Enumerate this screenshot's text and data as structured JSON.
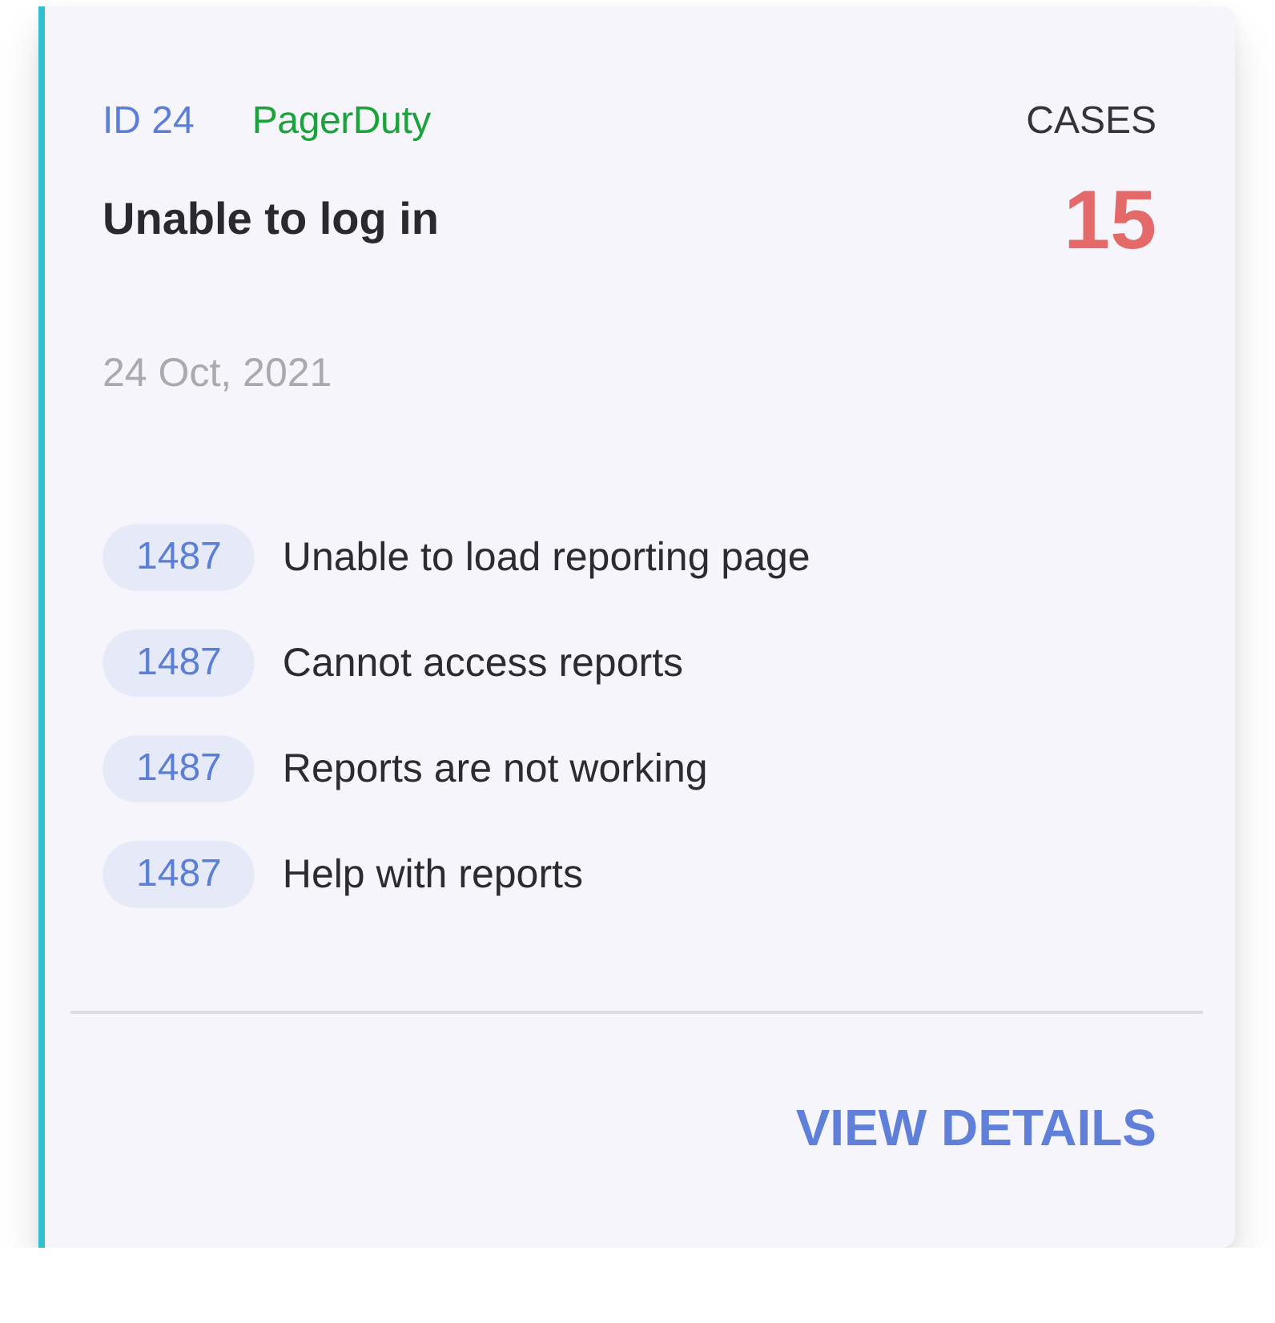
{
  "issue": {
    "id_label": "ID 24",
    "source": "PagerDuty",
    "title": "Unable to log in",
    "date": "24 Oct, 2021",
    "cases_label": "CASES",
    "cases_count": "15"
  },
  "related": [
    {
      "number": "1487",
      "text": "Unable to load reporting page"
    },
    {
      "number": "1487",
      "text": "Cannot access reports"
    },
    {
      "number": "1487",
      "text": "Reports are not working"
    },
    {
      "number": "1487",
      "text": "Help with reports"
    }
  ],
  "action": {
    "label": "VIEW DETAILS"
  }
}
